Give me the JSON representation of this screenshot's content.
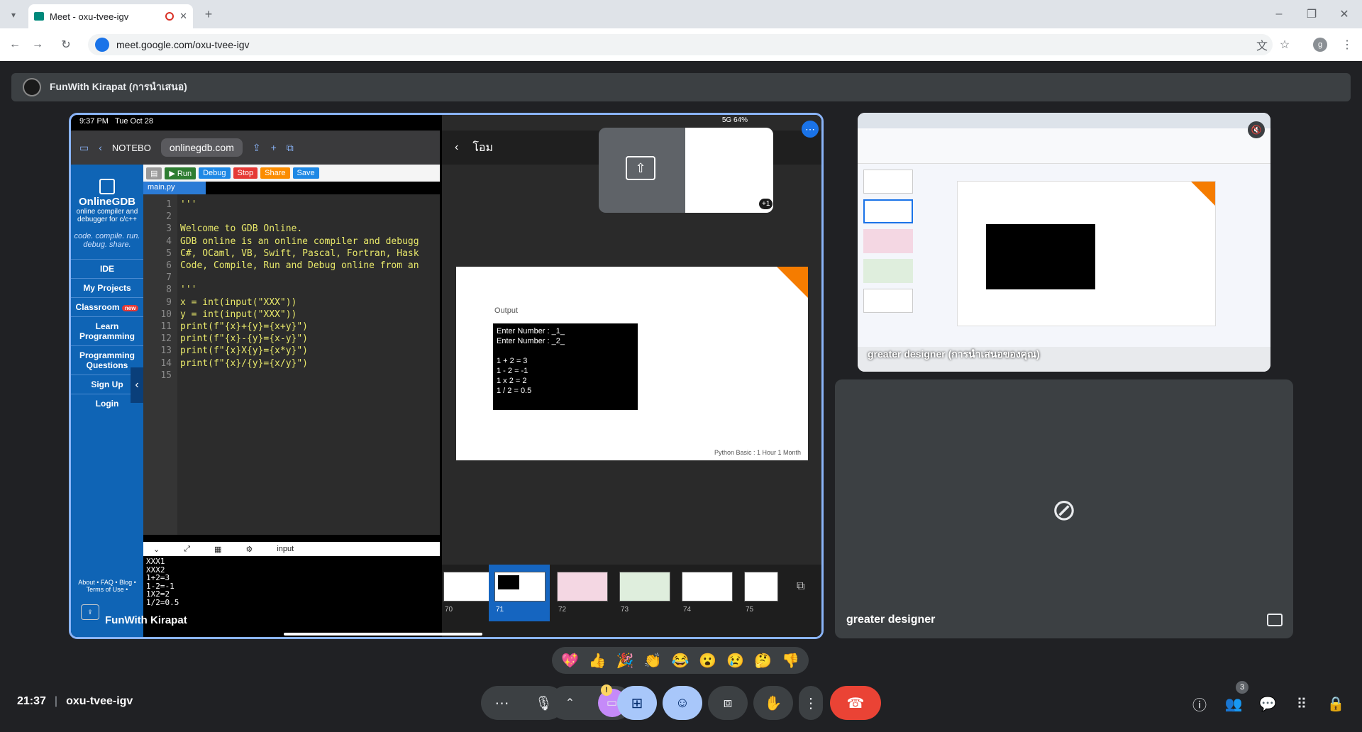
{
  "browser": {
    "tab_title": "Meet - oxu-tvee-igv",
    "url": "meet.google.com/oxu-tvee-igv",
    "profile_initial": "g"
  },
  "meet": {
    "presenter_bar": "FunWith Kirapat (การนำเสนอ)",
    "clock": "21:37",
    "meeting_code": "oxu-tvee-igv",
    "participant_count": "3",
    "main_tile_name": "FunWith Kirapat",
    "screen_tile_name": "greater designer (การนำเสนอของคุณ)",
    "cam_tile_name": "greater designer",
    "reactions": [
      "💖",
      "👍",
      "🎉",
      "👏",
      "😂",
      "😮",
      "😢",
      "🤔",
      "👎"
    ]
  },
  "ipad": {
    "time": "9:37 PM",
    "date": "Tue Oct 28",
    "signal": "5G 64%",
    "tab_label": "NOTEBO",
    "url": "onlinegdb.com",
    "slides_title": "โอม",
    "overlay_plus": "+1"
  },
  "gdb": {
    "brand": "OnlineGDB",
    "subtitle": "online compiler and debugger for c/c++",
    "tagline": "code. compile. run. debug. share.",
    "nav": [
      "IDE",
      "My Projects",
      "Classroom",
      "Learn Programming",
      "Programming Questions",
      "Sign Up",
      "Login"
    ],
    "classroom_badge": "new",
    "footer": "About • FAQ • Blog • Terms of Use •",
    "toolbar": {
      "run": "Run",
      "debug": "Debug",
      "stop": "Stop",
      "share": "Share",
      "save": "Save"
    },
    "file_tab": "main.py",
    "line_numbers": "1\n2\n3\n4\n5\n6\n7\n8\n9\n10\n11\n12\n13\n14\n15",
    "code": "'''\n\nWelcome to GDB Online.\nGDB online is an online compiler and debugg\nC#, OCaml, VB, Swift, Pascal, Fortran, Hask\nCode, Compile, Run and Debug online from an\n\n'''\nx = int(input(\"XXX\"))\ny = int(input(\"XXX\"))\nprint(f\"{x}+{y}={x+y}\")\nprint(f\"{x}-{y}={x-y}\")\nprint(f\"{x}X{y}={x*y}\")\nprint(f\"{x}/{y}={x/y}\")\n",
    "console_label": "input",
    "console_output": "XXX1\nXXX2\n1+2=3\n1-2=-1\n1X2=2\n1/2=0.5"
  },
  "slide": {
    "label": "Output",
    "terminal": "Enter Number : _1_\nEnter Number : _2_\n\n1 + 2 = 3\n1 - 2 = -1\n1 x 2 = 2\n1 / 2 = 0.5",
    "footer": "Python Basic : 1 Hour 1 Month",
    "thumbnail_numbers": [
      "70",
      "71",
      "72",
      "73",
      "74",
      "75"
    ]
  }
}
